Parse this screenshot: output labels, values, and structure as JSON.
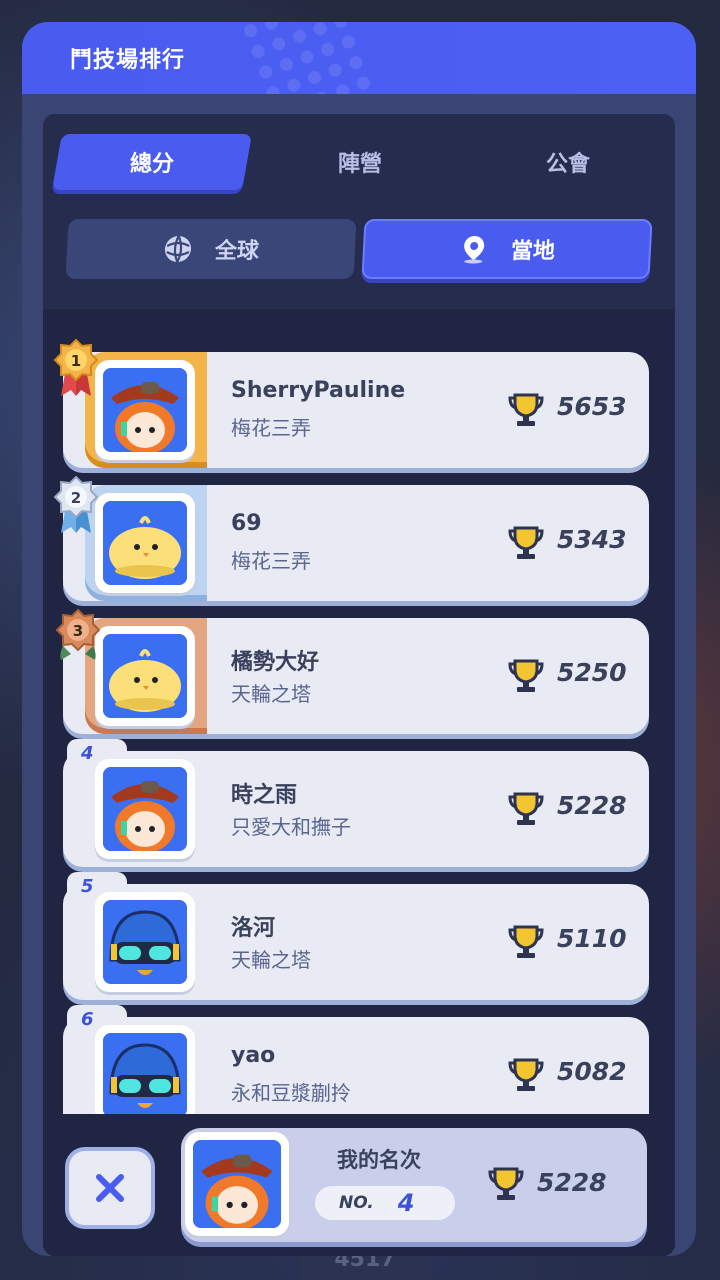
{
  "panel": {
    "title": "鬥技場排行"
  },
  "tabs": [
    {
      "label": "總分",
      "active": true
    },
    {
      "label": "陣營",
      "active": false
    },
    {
      "label": "公會",
      "active": false
    }
  ],
  "scope": {
    "global": {
      "label": "全球",
      "icon": "globe-icon",
      "active": false
    },
    "local": {
      "label": "當地",
      "icon": "location-pin-icon",
      "active": true
    }
  },
  "leaderboard": [
    {
      "rank": "1",
      "name": "SherryPauline",
      "guild": "梅花三弄",
      "score": "5653",
      "avatar": "red-hat-girl"
    },
    {
      "rank": "2",
      "name": "69",
      "guild": "梅花三弄",
      "score": "5343",
      "avatar": "yellow-chick"
    },
    {
      "rank": "3",
      "name": "橘勢大好",
      "guild": "天輪之塔",
      "score": "5250",
      "avatar": "yellow-chick"
    },
    {
      "rank": "4",
      "name": "時之雨",
      "guild": "只愛大和撫子",
      "score": "5228",
      "avatar": "red-hat-girl"
    },
    {
      "rank": "5",
      "name": "洛河",
      "guild": "天輪之塔",
      "score": "5110",
      "avatar": "blue-helmet"
    },
    {
      "rank": "6",
      "name": "yao",
      "guild": "永和豆漿蒯拎",
      "score": "5082",
      "avatar": "blue-helmet"
    }
  ],
  "my_rank": {
    "label": "我的名次",
    "no_label": "NO.",
    "rank": "4",
    "score": "5228"
  },
  "background": {
    "peek_text": "4517"
  },
  "colors": {
    "accent": "#4a5cf0",
    "trophy": "#f2c531",
    "gold": "#f3b54a",
    "silver": "#bcd4f2",
    "bronze": "#e4a680"
  }
}
